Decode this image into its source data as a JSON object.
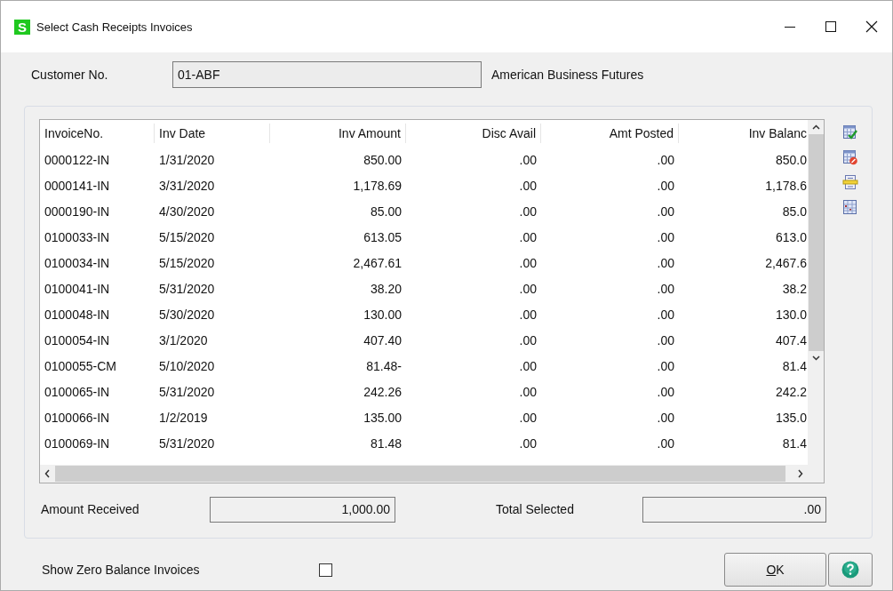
{
  "window": {
    "title": "Select Cash Receipts Invoices",
    "app_icon": "S"
  },
  "customer": {
    "label": "Customer No.",
    "value": "01-ABF",
    "name": "American Business Futures"
  },
  "table": {
    "columns": [
      "InvoiceNo.",
      "Inv Date",
      "Inv Amount",
      "Disc Avail",
      "Amt Posted",
      "Inv Balanc"
    ],
    "rows": [
      [
        "0000122-IN",
        "1/31/2020",
        "850.00",
        ".00",
        ".00",
        "850.0"
      ],
      [
        "0000141-IN",
        "3/31/2020",
        "1,178.69",
        ".00",
        ".00",
        "1,178.6"
      ],
      [
        "0000190-IN",
        "4/30/2020",
        "85.00",
        ".00",
        ".00",
        "85.0"
      ],
      [
        "0100033-IN",
        "5/15/2020",
        "613.05",
        ".00",
        ".00",
        "613.0"
      ],
      [
        "0100034-IN",
        "5/15/2020",
        "2,467.61",
        ".00",
        ".00",
        "2,467.6"
      ],
      [
        "0100041-IN",
        "5/31/2020",
        "38.20",
        ".00",
        ".00",
        "38.2"
      ],
      [
        "0100048-IN",
        "5/30/2020",
        "130.00",
        ".00",
        ".00",
        "130.0"
      ],
      [
        "0100054-IN",
        "3/1/2020",
        "407.40",
        ".00",
        ".00",
        "407.4"
      ],
      [
        "0100055-CM",
        "5/10/2020",
        "81.48-",
        ".00",
        ".00",
        "81.4"
      ],
      [
        "0100065-IN",
        "5/31/2020",
        "242.26",
        ".00",
        ".00",
        "242.2"
      ],
      [
        "0100066-IN",
        "1/2/2019",
        "135.00",
        ".00",
        ".00",
        "135.0"
      ],
      [
        "0100069-IN",
        "5/31/2020",
        "81.48",
        ".00",
        ".00",
        "81.4"
      ]
    ]
  },
  "amount_received": {
    "label": "Amount Received",
    "value": "1,000.00"
  },
  "total_selected": {
    "label": "Total Selected",
    "value": ".00"
  },
  "show_zero_balance": {
    "label": "Show Zero Balance Invoices",
    "checked": false
  },
  "buttons": [
    {
      "kind": "ok",
      "label": "OK"
    },
    {
      "kind": "help"
    }
  ]
}
